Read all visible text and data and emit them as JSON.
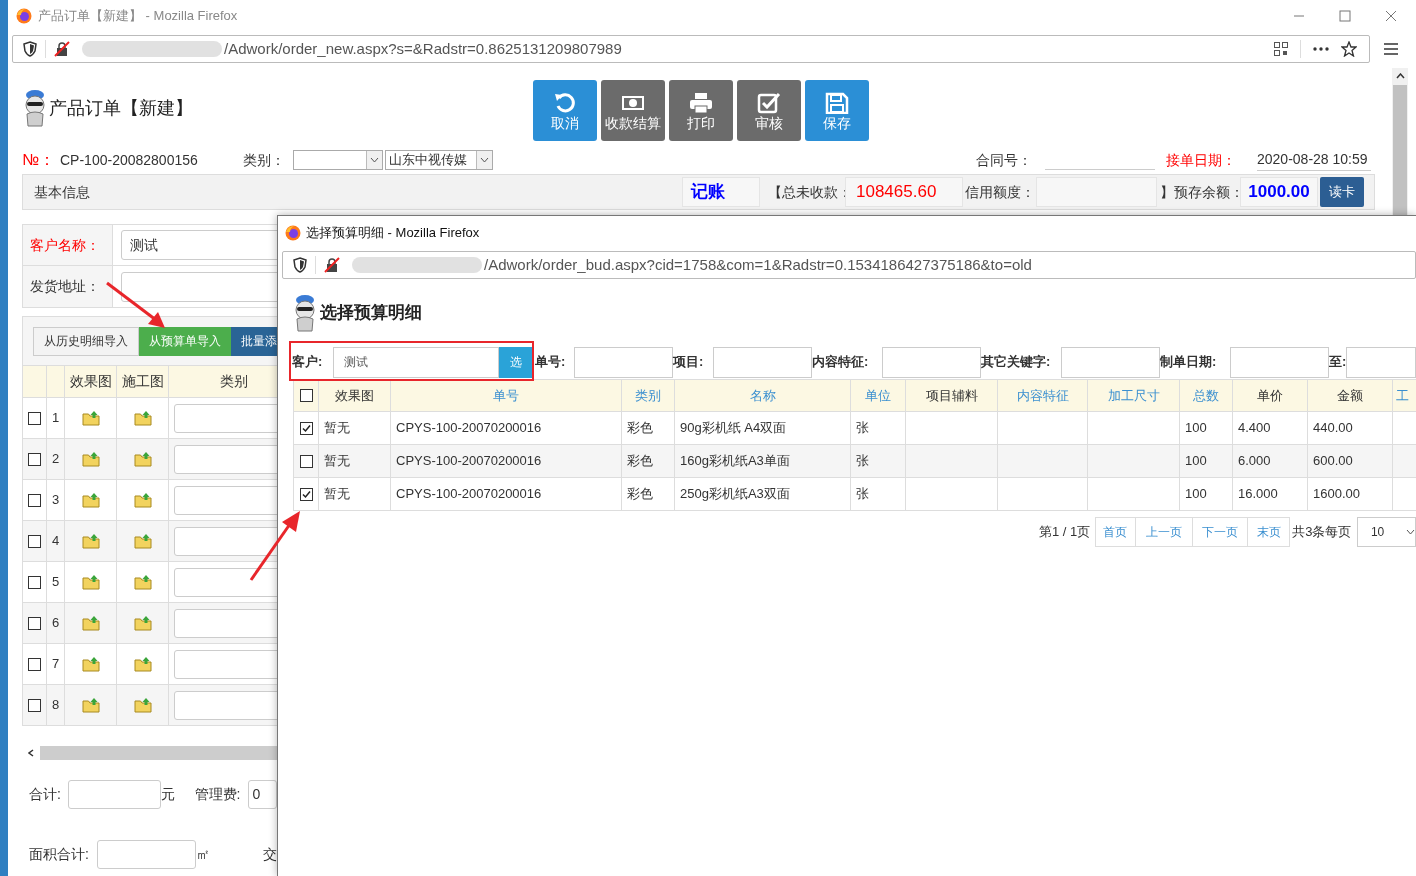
{
  "main_window": {
    "title": "产品订单【新建】 - Mozilla Firefox",
    "url": "/Adwork/order_new.aspx?s=&Radstr=0.8625131209807989",
    "page_title": "产品订单【新建】",
    "toolbar": [
      {
        "label": "取消",
        "kind": "undo",
        "color": "#2b8fd6"
      },
      {
        "label": "收款结算",
        "kind": "money",
        "color": "#6b6b6b"
      },
      {
        "label": "打印",
        "kind": "print",
        "color": "#6b6b6b"
      },
      {
        "label": "审核",
        "kind": "approve",
        "color": "#6b6b6b"
      },
      {
        "label": "保存",
        "kind": "save",
        "color": "#2b8fd6"
      }
    ],
    "order": {
      "no_label": "№：",
      "no": "CP-100-20082800156",
      "category_label": "类别：",
      "company": "山东中视传媒",
      "contract_label": "合同号：",
      "date_label": "接单日期：",
      "date": "2020-08-28 10:59"
    },
    "info_bar": {
      "title": "基本信息",
      "post_link": "记账",
      "unpaid_label": "【总未收款：",
      "unpaid": "108465.60",
      "credit_label": "信用额度：",
      "balance_label": "】预存余额：",
      "balance": "1000.00",
      "read_card": "读卡"
    },
    "customer_label": "客户名称：",
    "customer": "测试",
    "address_label": "发货地址：",
    "import_buttons": [
      {
        "label": "从历史明细导入",
        "kind": "plain"
      },
      {
        "label": "从预算单导入",
        "kind": "green"
      },
      {
        "label": "批量添",
        "kind": "blue"
      }
    ],
    "grid_columns": [
      "效果图",
      "施工图",
      "类别"
    ],
    "grid_rows": [
      {
        "no": "1",
        "checked": false
      },
      {
        "no": "2",
        "checked": false
      },
      {
        "no": "3",
        "checked": false
      },
      {
        "no": "4",
        "checked": false
      },
      {
        "no": "5",
        "checked": false
      },
      {
        "no": "6",
        "checked": false
      },
      {
        "no": "7",
        "checked": false
      },
      {
        "no": "8",
        "checked": false
      }
    ],
    "totals": {
      "sum_label": "合计:",
      "sum_unit": "元",
      "fee_label": "管理费:",
      "fee": "0",
      "area_label": "面积合计:",
      "area_unit": "㎡",
      "next_label": "交"
    }
  },
  "popup": {
    "title": "选择预算明细 - Mozilla Firefox",
    "url": "/Adwork/order_bud.aspx?cid=1758&com=1&Radstr=0.1534186427375186&to=old",
    "heading": "选择预算明细",
    "filters": [
      {
        "label": "客户:",
        "kind": "picker",
        "value": "测试",
        "button": "选"
      },
      {
        "label": "单号:",
        "kind": "text"
      },
      {
        "label": "项目:",
        "kind": "text"
      },
      {
        "label": "内容特征:",
        "kind": "text"
      },
      {
        "label": "其它关键字:",
        "kind": "text"
      },
      {
        "label": "制单日期:",
        "kind": "text"
      },
      {
        "label": "至:",
        "kind": "text"
      }
    ],
    "header_checked": false,
    "columns": [
      {
        "label": "效果图",
        "link": false
      },
      {
        "label": "单号",
        "link": true
      },
      {
        "label": "类别",
        "link": true
      },
      {
        "label": "名称",
        "link": true
      },
      {
        "label": "单位",
        "link": true
      },
      {
        "label": "项目辅料",
        "link": false
      },
      {
        "label": "内容特征",
        "link": true
      },
      {
        "label": "加工尺寸",
        "link": true
      },
      {
        "label": "总数",
        "link": true
      },
      {
        "label": "单价",
        "link": false
      },
      {
        "label": "金额",
        "link": false
      },
      {
        "label": "工",
        "link": true
      }
    ],
    "rows": [
      {
        "checked": true,
        "image": "暂无",
        "number": "CPYS-100-20070200016",
        "category": "彩色",
        "name": "90g彩机纸 A4双面",
        "unit": "张",
        "qty": "100",
        "price": "4.400",
        "amount": "440.00"
      },
      {
        "checked": false,
        "image": "暂无",
        "number": "CPYS-100-20070200016",
        "category": "彩色",
        "name": "160g彩机纸A3单面",
        "unit": "张",
        "qty": "100",
        "price": "6.000",
        "amount": "600.00"
      },
      {
        "checked": true,
        "image": "暂无",
        "number": "CPYS-100-20070200016",
        "category": "彩色",
        "name": "250g彩机纸A3双面",
        "unit": "张",
        "qty": "100",
        "price": "16.000",
        "amount": "1600.00"
      }
    ],
    "pager": {
      "info": "第1 / 1页",
      "buttons": [
        "首页",
        "上一页",
        "下一页",
        "末页"
      ],
      "total": "共3条每页",
      "page_size": "10"
    }
  }
}
